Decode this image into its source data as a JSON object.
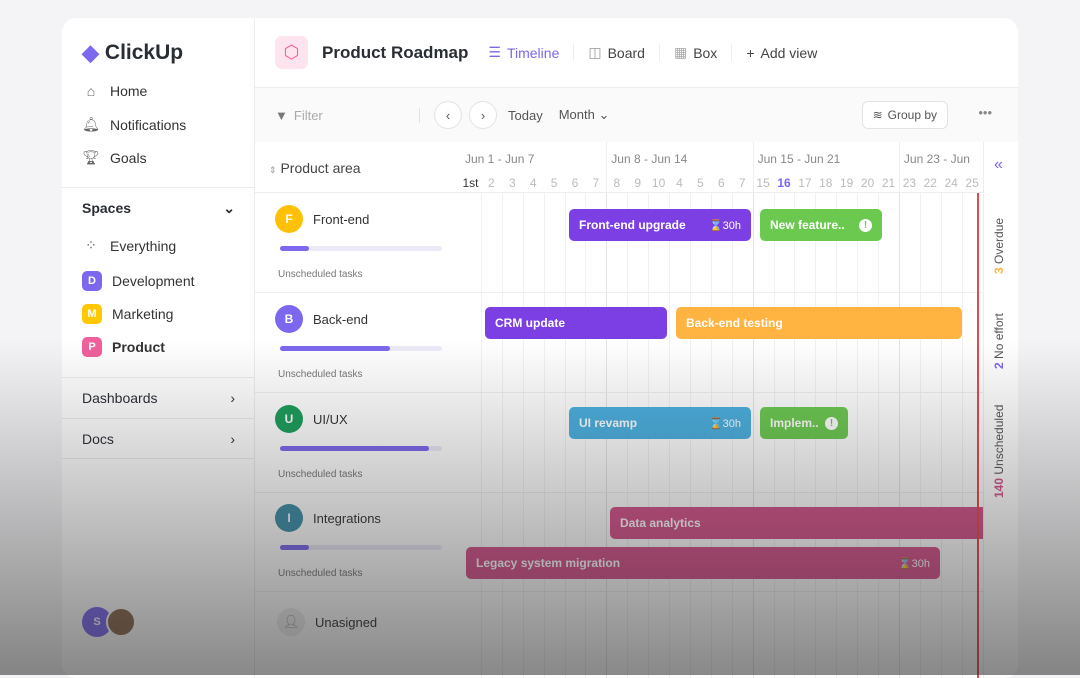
{
  "app": {
    "name": "ClickUp"
  },
  "sidebar": {
    "nav": [
      {
        "label": "Home",
        "icon": "home-icon"
      },
      {
        "label": "Notifications",
        "icon": "bell-icon"
      },
      {
        "label": "Goals",
        "icon": "trophy-icon"
      }
    ],
    "spaces_label": "Spaces",
    "everything": "Everything",
    "spaces": [
      {
        "letter": "D",
        "label": "Development",
        "color": "#7b68ee"
      },
      {
        "letter": "M",
        "label": "Marketing",
        "color": "#ffc800"
      },
      {
        "letter": "P",
        "label": "Product",
        "color": "#f0609a"
      }
    ],
    "dashboards": "Dashboards",
    "docs": "Docs",
    "user_initial": "S"
  },
  "header": {
    "title": "Product Roadmap",
    "views": [
      {
        "label": "Timeline",
        "active": true
      },
      {
        "label": "Board"
      },
      {
        "label": "Box"
      }
    ],
    "add_view": "Add view"
  },
  "toolbar": {
    "filter": "Filter",
    "today": "Today",
    "month": "Month",
    "group_by": "Group by"
  },
  "timeline": {
    "column_header": "Product area",
    "weeks": [
      "Jun 1 - Jun 7",
      "Jun 8 - Jun 14",
      "Jun 15 - Jun 21",
      "Jun 23 - Jun"
    ],
    "days": [
      "1st",
      "2",
      "3",
      "4",
      "5",
      "6",
      "7",
      "8",
      "9",
      "10",
      "4",
      "5",
      "6",
      "7",
      "15",
      "16",
      "17",
      "18",
      "19",
      "20",
      "21",
      "23",
      "22",
      "24",
      "25"
    ],
    "today_day": "16",
    "rows": [
      {
        "initial": "F",
        "name": "Front-end",
        "color": "#ffc107",
        "progress": 0.18,
        "unscheduled": "Unscheduled tasks"
      },
      {
        "initial": "B",
        "name": "Back-end",
        "color": "#7b68ee",
        "progress": 0.68,
        "unscheduled": "Unscheduled tasks"
      },
      {
        "initial": "U",
        "name": "UI/UX",
        "color": "#1a9e5a",
        "progress": 0.92,
        "unscheduled": "Unscheduled tasks"
      },
      {
        "initial": "I",
        "name": "Integrations",
        "color": "#3d8fa8",
        "progress": 0.18,
        "unscheduled": "Unscheduled tasks"
      }
    ],
    "unassigned": "Unasigned",
    "bars": [
      {
        "label": "Front-end upgrade",
        "hours": "30h",
        "color": "#7b3fe4"
      },
      {
        "label": "New feature..",
        "color": "#6bc950",
        "warn": true
      },
      {
        "label": "CRM update",
        "color": "#7b3fe4"
      },
      {
        "label": "Back-end testing",
        "color": "#ffb340"
      },
      {
        "label": "UI revamp",
        "hours": "30h",
        "color": "#4ab0e0"
      },
      {
        "label": "Implem..",
        "color": "#6bc950",
        "warn": true
      },
      {
        "label": "Data analytics",
        "color": "#d4528a"
      },
      {
        "label": "Legacy system migration",
        "hours": "30h",
        "color": "#d4528a"
      }
    ]
  },
  "right_panel": {
    "overdue_count": "3",
    "overdue": "Overdue",
    "noeffort_count": "2",
    "noeffort": "No effort",
    "unscheduled_count": "140",
    "unscheduled": "Unscheduled"
  }
}
